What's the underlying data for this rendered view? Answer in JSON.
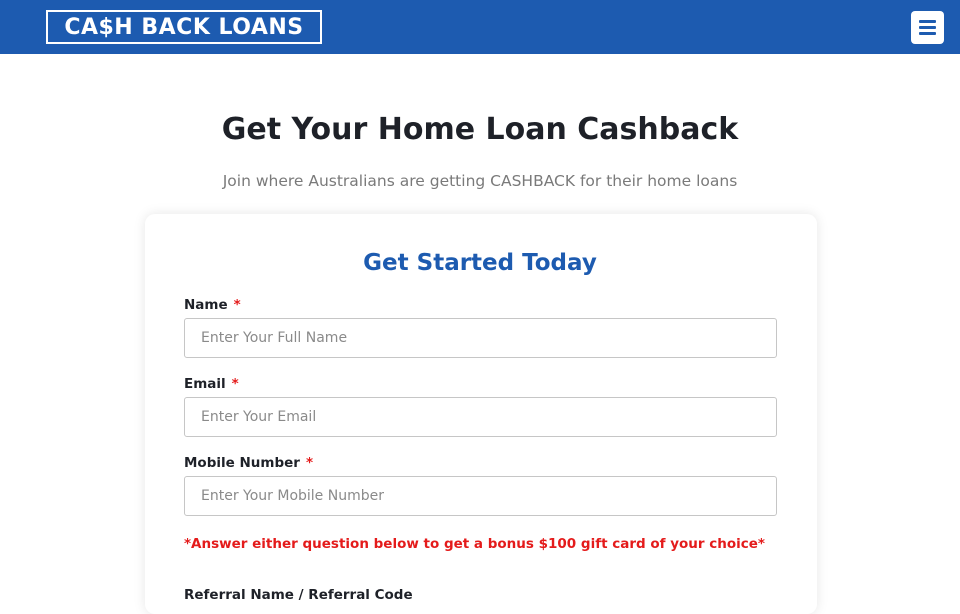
{
  "header": {
    "logo_text": "CA$H BACK LOANS",
    "menu_icon": "hamburger-menu-icon",
    "brand_color": "#1d5bb0"
  },
  "hero": {
    "title": "Get Your Home Loan Cashback",
    "subtitle": "Join where Australians are getting CASHBACK for their home loans"
  },
  "form": {
    "title": "Get Started Today",
    "required_marker": "*",
    "fields": [
      {
        "label": "Name",
        "placeholder": "Enter Your Full Name",
        "value": ""
      },
      {
        "label": "Email",
        "placeholder": "Enter Your Email",
        "value": ""
      },
      {
        "label": "Mobile Number",
        "placeholder": "Enter Your Mobile Number",
        "value": ""
      }
    ],
    "bonus_note": "*Answer either question below to get a bonus $100 gift card of your choice*",
    "referral_label": "Referral Name / Referral Code",
    "required_color": "#e41b1b"
  }
}
